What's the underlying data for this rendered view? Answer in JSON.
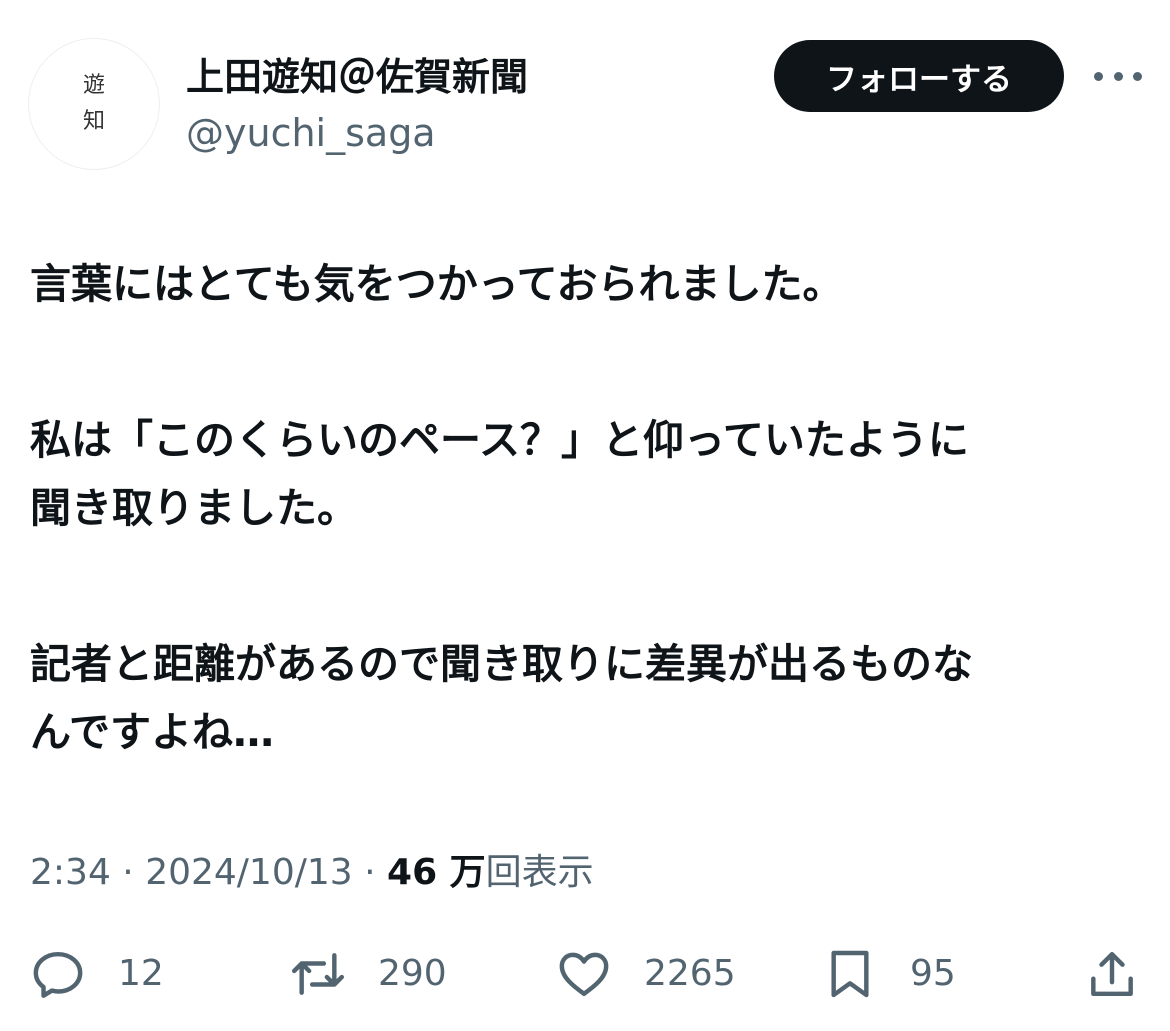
{
  "author": {
    "avatar_chars": [
      "遊",
      "知"
    ],
    "display_name": "上田遊知＠佐賀新聞",
    "handle": "@yuchi_saga"
  },
  "follow_label": "フォローする",
  "tweet": {
    "paragraphs": [
      [
        "言葉にはとても気をつかっておられました。"
      ],
      [
        "私は「このくらいのペース？」と仰っていたように",
        "聞き取りました。"
      ],
      [
        "記者と距離があるので聞き取りに差異が出るものな",
        "んですよね…"
      ]
    ]
  },
  "meta": {
    "time": "2:34",
    "separator": " · ",
    "date": "2024/10/13",
    "views_count": "46 万",
    "views_label": "回表示"
  },
  "actions": {
    "reply": "12",
    "retweet": "290",
    "like": "2265",
    "bookmark": "95"
  },
  "icons": {
    "reply": "reply-icon",
    "retweet": "retweet-icon",
    "like": "heart-icon",
    "bookmark": "bookmark-icon",
    "share": "share-icon",
    "more": "more-icon"
  },
  "colors": {
    "text": "#0f1419",
    "secondary": "#536471",
    "button_bg": "#0f1419",
    "button_text": "#ffffff"
  }
}
